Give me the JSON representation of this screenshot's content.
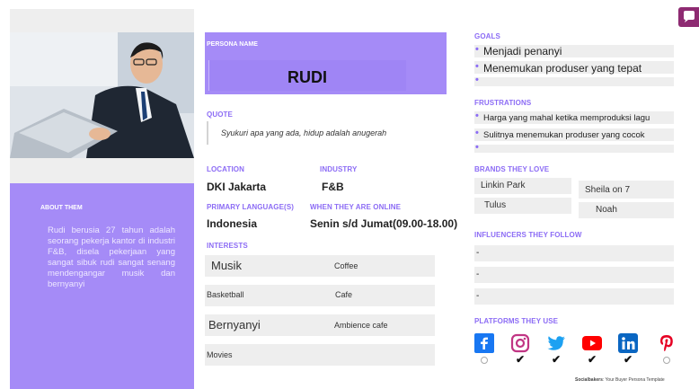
{
  "persona": {
    "label": "PERSONA NAME",
    "name": "RUDI"
  },
  "quote": {
    "label": "QUOTE",
    "text": "Syukuri apa yang ada, hidup adalah anugerah"
  },
  "about": {
    "title": "ABOUT THEM",
    "text": "Rudi berusia 27 tahun adalah seorang pekerja kantor di industri F&B, disela pekerjaan yang sangat sibuk rudi sangat senang mendengangar musik dan bernyanyi"
  },
  "location": {
    "label": "LOCATION",
    "value": "DKI Jakarta"
  },
  "industry": {
    "label": "INDUSTRY",
    "value": "F&B"
  },
  "language": {
    "label": "PRIMARY LANGUAGE(S)",
    "value": "Indonesia"
  },
  "online": {
    "label": "WHEN THEY ARE ONLINE",
    "value": "Senin s/d Jumat(09.00-18.00)"
  },
  "interests": {
    "label": "INTERESTS",
    "items": [
      {
        "left": "Musik",
        "right": "Coffee"
      },
      {
        "left": "Basketball",
        "right": "Cafe"
      },
      {
        "left": "Bernyanyi",
        "right": "Ambience cafe"
      },
      {
        "left": "Movies",
        "right": ""
      }
    ]
  },
  "goals": {
    "label": "GOALS",
    "items": [
      "Menjadi penanyi",
      "Menemukan produser yang tepat",
      ""
    ]
  },
  "frustrations": {
    "label": "FRUSTRATIONS",
    "items": [
      "Harga yang mahal ketika memproduksi lagu",
      "Sulitnya menemukan produser yang cocok",
      ""
    ]
  },
  "brands": {
    "label": "BRANDS THEY LOVE",
    "items": [
      "Linkin Park",
      "Sheila on 7",
      "Tulus",
      "Noah"
    ]
  },
  "influencers": {
    "label": "INFLUENCERS THEY FOLLOW",
    "items": [
      "-",
      "-",
      "-"
    ]
  },
  "platforms": {
    "label": "PLATFORMS THEY USE",
    "items": [
      {
        "icon": "facebook-icon",
        "color": "#1877f2",
        "used": false
      },
      {
        "icon": "instagram-icon",
        "color": "#c13584",
        "used": true
      },
      {
        "icon": "twitter-icon",
        "color": "#1da1f2",
        "used": true
      },
      {
        "icon": "youtube-icon",
        "color": "#ff0000",
        "used": true
      },
      {
        "icon": "linkedin-icon",
        "color": "#0a66c2",
        "used": true
      },
      {
        "icon": "pinterest-icon",
        "color": "#e60023",
        "used": false
      }
    ],
    "check_mark": "✔"
  },
  "footer": {
    "brand": "Socialbakers",
    "text": ": Your Buyer Persona Template"
  },
  "colors": {
    "accent": "#8c6cf5",
    "panel": "#a58bf7",
    "grey": "#eeeeee"
  }
}
